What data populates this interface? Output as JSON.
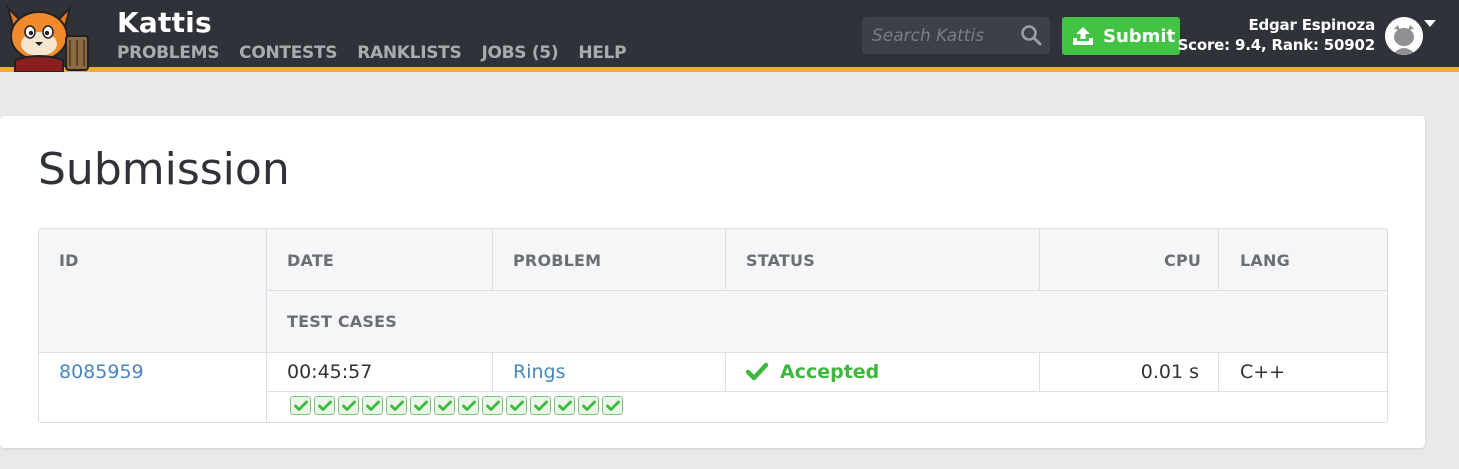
{
  "header": {
    "brand": "Kattis",
    "nav": [
      {
        "label": "PROBLEMS"
      },
      {
        "label": "CONTESTS"
      },
      {
        "label": "RANKLISTS"
      },
      {
        "label": "JOBS (5)"
      },
      {
        "label": "HELP"
      }
    ],
    "search_placeholder": "Search Kattis",
    "submit_label": "Submit",
    "user_name": "Edgar Espinoza",
    "user_stats": "Score: 9.4, Rank: 50902"
  },
  "page": {
    "title": "Submission"
  },
  "table": {
    "headers": {
      "id": "ID",
      "date": "DATE",
      "problem": "PROBLEM",
      "status": "STATUS",
      "cpu": "CPU",
      "lang": "LANG",
      "test_cases": "TEST CASES"
    },
    "row": {
      "id": "8085959",
      "date": "00:45:57",
      "problem": "Rings",
      "status": "Accepted",
      "cpu": "0.01 s",
      "lang": "C++"
    },
    "test_cases": {
      "passed": 14,
      "total": 14
    }
  },
  "colors": {
    "topbar": "#30323a",
    "accent": "#f0ad33",
    "submit": "#43c343",
    "link": "#4b86bd",
    "accepted": "#3db83d"
  }
}
